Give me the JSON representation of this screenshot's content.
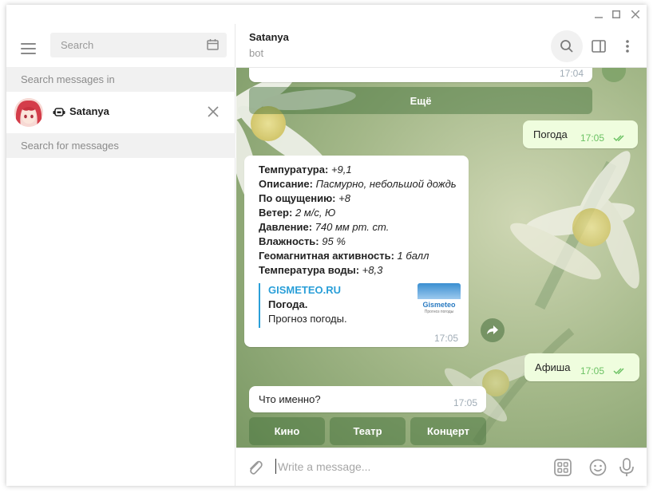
{
  "window": {
    "minimize": "_",
    "maximize": "□",
    "close": "×"
  },
  "sidebar": {
    "search_placeholder": "Search",
    "search_in_label": "Search messages in",
    "peer_name": "Satanya",
    "search_for_label": "Search for messages"
  },
  "header": {
    "title": "Satanya",
    "subtitle": "bot"
  },
  "messages": {
    "top_time": "17:04",
    "more_button": "Ещё",
    "out1_text": "Погода",
    "out1_time": "17:05",
    "weather": {
      "lines": [
        {
          "label": "Темпуратура:",
          "value": "+9,1"
        },
        {
          "label": "Описание:",
          "value": "Пасмурно, небольшой дождь"
        },
        {
          "label": "По ощущению:",
          "value": "+8"
        },
        {
          "label": "Ветер:",
          "value": "2 м/с, Ю"
        },
        {
          "label": "Давление:",
          "value": "740 мм рт. ст."
        },
        {
          "label": "Влажность:",
          "value": "95 %"
        },
        {
          "label": "Геомагнитная активность:",
          "value": "1 балл"
        },
        {
          "label": "Температура воды:",
          "value": "+8,3"
        }
      ],
      "preview_site": "GISMETEO.RU",
      "preview_title": "Погода.",
      "preview_desc": "Прогноз погоды.",
      "thumb_logo": "Gismeteo",
      "thumb_tagline": "Прогноз погоды",
      "time": "17:05"
    },
    "out2_text": "Афиша",
    "out2_time": "17:05",
    "in2_text": "Что именно?",
    "in2_time": "17:05",
    "keyboard": [
      "Кино",
      "Театр",
      "Концерт"
    ]
  },
  "composer": {
    "placeholder": "Write a message..."
  },
  "colors": {
    "accent": "#2a9fd8",
    "read_check": "#6cc264",
    "outgoing_bg": "#effdde"
  }
}
